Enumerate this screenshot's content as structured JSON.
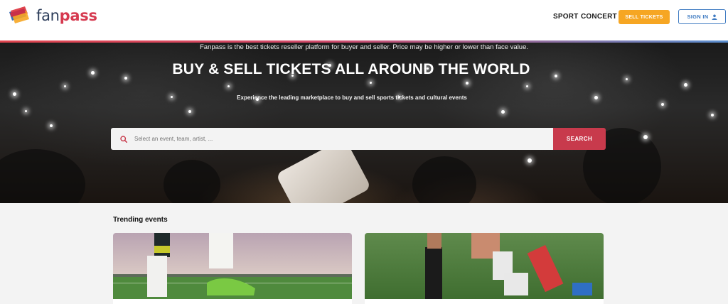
{
  "brand": {
    "name_part1": "fan",
    "name_part2": "pass",
    "colors": {
      "primary": "#d63a50",
      "dark": "#2d3d5a",
      "accent": "#f6a623",
      "link": "#3f7bc2"
    }
  },
  "nav": {
    "sport_label": "SPORT",
    "concert_label": "CONCERT",
    "sell_label": "SELL TICKETS",
    "signin_label": "SIGN IN",
    "signin_icon": "user-icon"
  },
  "hero": {
    "disclaimer": "Fanpass is the best tickets reseller platform for buyer and seller. Price may be higher or lower than face value.",
    "title": "BUY & SELL TICKETS ALL AROUND THE WORLD",
    "subtitle": "Experience the leading marketplace to buy and sell sports tickets and cultural events",
    "search_placeholder": "Select an event, team, artist, ...",
    "search_button": "SEARCH",
    "search_icon": "search-icon"
  },
  "trending": {
    "title": "Trending events",
    "cards": [
      {
        "image": "football-boots-on-pitch"
      },
      {
        "image": "football-players-tackling"
      }
    ]
  }
}
